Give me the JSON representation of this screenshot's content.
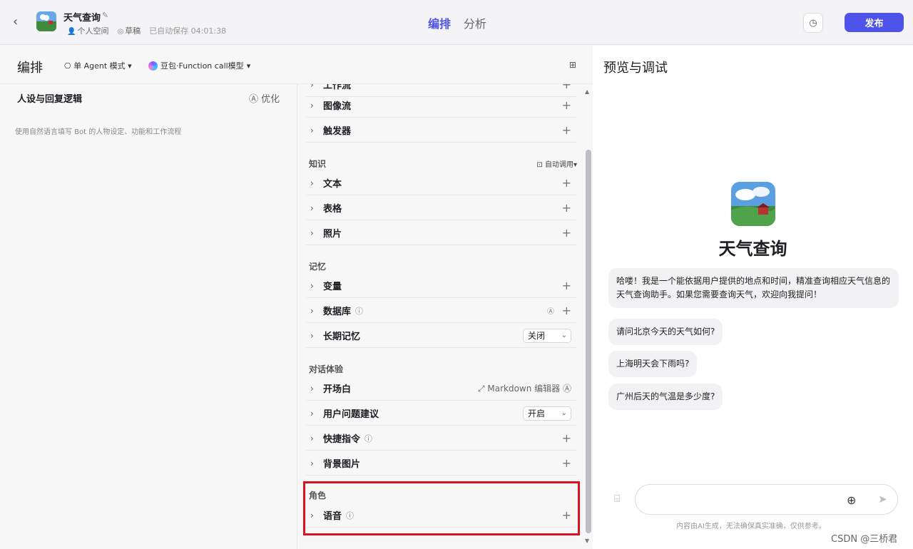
{
  "header": {
    "bot_title": "天气查询",
    "space": "个人空间",
    "status": "草稿",
    "autosave": "已自动保存 04:01:38",
    "tabs": [
      "编排",
      "分析"
    ],
    "publish_label": "发布",
    "accent": "#4d53e8"
  },
  "edit": {
    "title": "编排",
    "mode": "单 Agent 模式",
    "model": "豆包·Function call模型",
    "persona_title": "人设与回复逻辑",
    "optimize_label": "优化",
    "persona_placeholder": "使用自然语言填写 Bot 的人物设定、功能和工作流程"
  },
  "skills": {
    "partial_label": "工作流",
    "rows": [
      "图像流",
      "触发器"
    ]
  },
  "knowledge": {
    "title": "知识",
    "auto_call": "自动调用",
    "rows": [
      "文本",
      "表格",
      "照片"
    ]
  },
  "memory": {
    "title": "记忆",
    "variable": "变量",
    "database": "数据库",
    "long_term": "长期记忆",
    "long_term_value": "关闭"
  },
  "dialog": {
    "title": "对话体验",
    "opening": "开场白",
    "markdown_editor": "Markdown 编辑器",
    "suggestions": "用户问题建议",
    "suggestions_value": "开启",
    "shortcut": "快捷指令",
    "background": "背景图片"
  },
  "role": {
    "title": "角色",
    "voice": "语音"
  },
  "preview": {
    "title": "预览与调试",
    "bot_name": "天气查询",
    "greeting": "哈喽！我是一个能依据用户提供的地点和时间，精准查询相应天气信息的天气查询助手。如果您需要查询天气，欢迎向我提问！",
    "suggestions": [
      "请问北京今天的天气如何?",
      "上海明天会下雨吗?",
      "广州后天的气温是多少度?"
    ],
    "input_placeholder": "",
    "disclaimer": "内容由AI生成，无法确保真实准确，仅供参考。"
  },
  "watermark": "CSDN @三桥君"
}
